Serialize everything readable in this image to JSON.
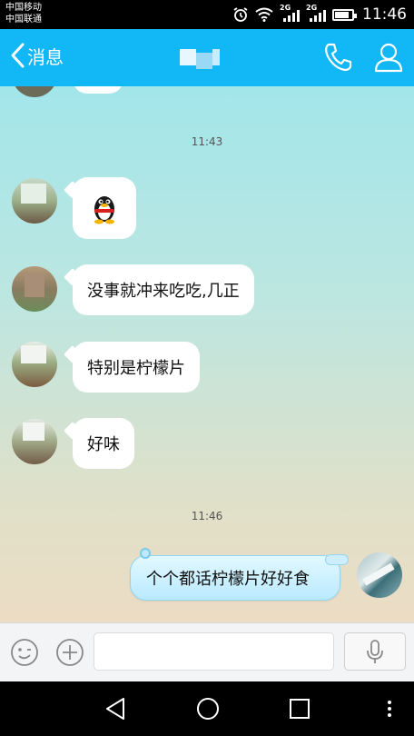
{
  "status_bar": {
    "carrier_1": "中国移动",
    "carrier_2": "中国联通",
    "sim1_network": "2G",
    "sim2_network": "2G",
    "time": "11:46",
    "battery_level": 0.75
  },
  "header": {
    "back_label": "消息",
    "accent_color": "#12b7f5"
  },
  "chat": {
    "messages_section_1_time": "11:43",
    "incoming": [
      {
        "type": "sticker",
        "icon": "qq-penguin-sticker"
      },
      {
        "type": "text",
        "text": "没事就冲来吃吃,几正"
      },
      {
        "type": "text",
        "text": "特别是柠檬片"
      },
      {
        "type": "text",
        "text": "好味"
      }
    ],
    "messages_section_2_time": "11:46",
    "outgoing": [
      {
        "type": "text",
        "text": "个个都话柠檬片好好食"
      }
    ]
  },
  "input_bar": {
    "text_value": "",
    "icons": [
      "emoji-icon",
      "plus-icon",
      "microphone-icon"
    ]
  },
  "nav_bar": {
    "icons": [
      "back-triangle-icon",
      "home-circle-icon",
      "recents-square-icon",
      "more-dots-icon"
    ]
  }
}
